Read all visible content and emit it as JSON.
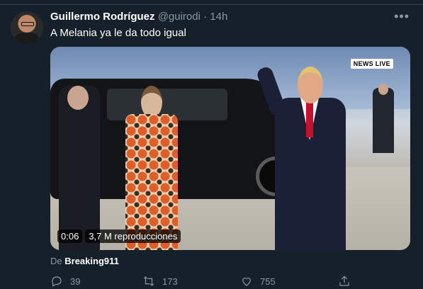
{
  "tweet": {
    "author_name": "Guillermo Rodríguez",
    "handle": "@guirodi",
    "separator": "·",
    "time": "14h",
    "more_icon": "more-dots-icon",
    "text": "A Melania ya le da todo igual"
  },
  "media": {
    "watermark": "NEWS LIVE",
    "duration": "0:06",
    "views": "3,7 M reproducciones"
  },
  "source": {
    "prefix": "De",
    "account": "Breaking911"
  },
  "actions": {
    "replies": "39",
    "retweets": "173",
    "likes": "755"
  },
  "colors": {
    "background": "#15202b",
    "secondary_text": "#8899a6"
  }
}
